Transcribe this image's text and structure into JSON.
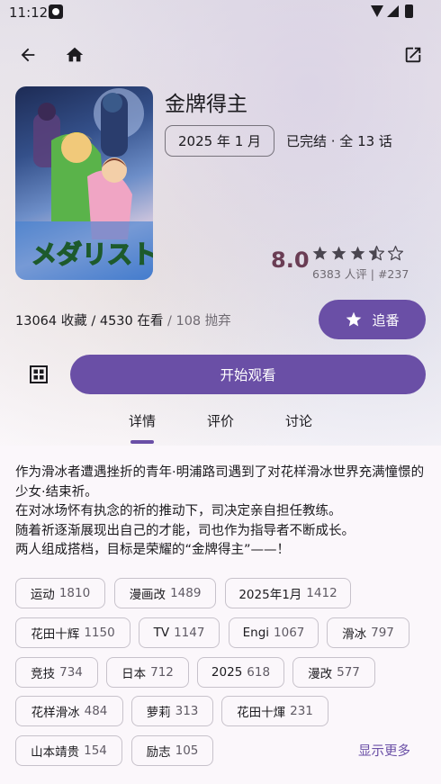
{
  "status_bar": {
    "time": "11:12"
  },
  "anime": {
    "title": "金牌得主",
    "date": "2025 年 1 月",
    "status": "已完结 · 全 13 话",
    "score": "8.0",
    "rating_fraction": 0.7,
    "rating_meta": "6383 人评 | #237",
    "stats_main": "13064 收藏 / 4530 在看",
    "stats_dim": " / 108 抛弃"
  },
  "actions": {
    "follow_label": "追番",
    "watch_label": "开始观看"
  },
  "tabs": [
    "详情",
    "评价",
    "讨论"
  ],
  "summary": "作为滑冰者遭遇挫折的青年·明浦路司遇到了对花样滑冰世界充满憧憬的少女·结束祈。\n在对冰场怀有执念的祈的推动下，司决定亲自担任教练。\n随着祈逐渐展现出自己的才能，司也作为指导者不断成长。\n两人组成搭档，目标是荣耀的“金牌得主”——！",
  "tags": [
    {
      "name": "运动",
      "count": "1810"
    },
    {
      "name": "漫画改",
      "count": "1489"
    },
    {
      "name": "2025年1月",
      "count": "1412"
    },
    {
      "name": "花田十辉",
      "count": "1150"
    },
    {
      "name": "TV",
      "count": "1147"
    },
    {
      "name": "Engi",
      "count": "1067"
    },
    {
      "name": "滑冰",
      "count": "797"
    },
    {
      "name": "竞技",
      "count": "734"
    },
    {
      "name": "日本",
      "count": "712"
    },
    {
      "name": "2025",
      "count": "618"
    },
    {
      "name": "漫改",
      "count": "577"
    },
    {
      "name": "花样滑冰",
      "count": "484"
    },
    {
      "name": "萝莉",
      "count": "313"
    },
    {
      "name": "花田十煇",
      "count": "231"
    },
    {
      "name": "山本靖贵",
      "count": "154"
    },
    {
      "name": "励志",
      "count": "105"
    }
  ],
  "show_more": "显示更多",
  "colors": {
    "accent": "#6a4fa6",
    "score": "#6a3d54"
  },
  "icons": [
    "back-arrow-icon",
    "home-icon",
    "open-external-icon",
    "star-icon",
    "grid-icon"
  ]
}
